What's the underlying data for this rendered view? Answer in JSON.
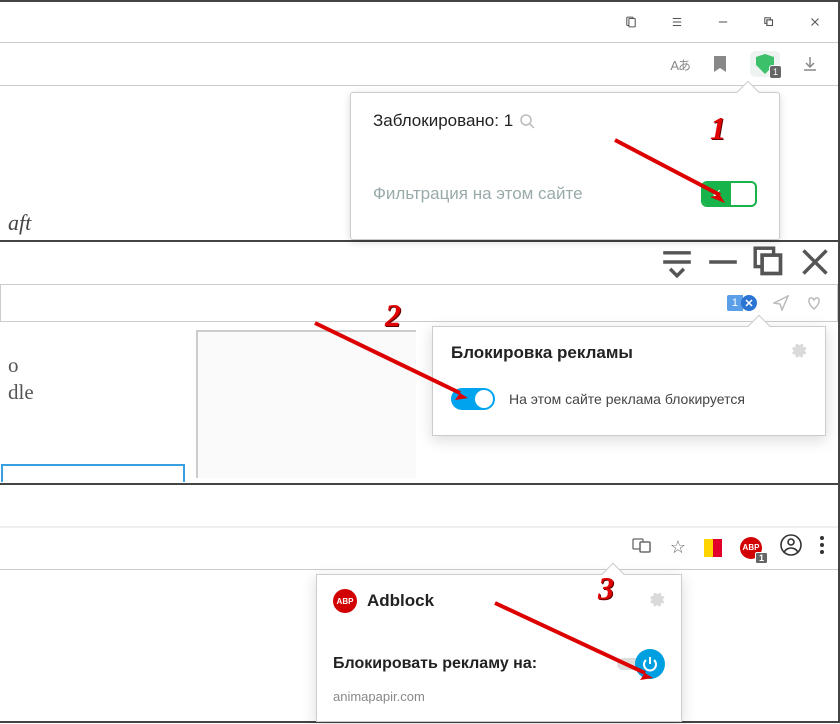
{
  "section1": {
    "window_controls": [
      "bookmarks",
      "menu",
      "minimize",
      "maximize",
      "close"
    ],
    "toolbar": {
      "translate_label": "Aあ",
      "extension_badge": "1"
    },
    "popup": {
      "blocked_label": "Заблокировано: 1",
      "filter_label": "Фильтрация на этом сайте",
      "toggle_on": true,
      "check": "✓"
    },
    "page_fragment": "aft"
  },
  "section2": {
    "toolbar": {
      "ext_count": "1",
      "stop_mark": "✕"
    },
    "popup": {
      "title": "Блокировка рекламы",
      "status_text": "На этом сайте реклама блокируется",
      "toggle_on": true
    },
    "page_fragment_line1": "o",
    "page_fragment_line2": "dle"
  },
  "section3": {
    "toolbar": {
      "abp_badge": "1",
      "abp_text": "ABP"
    },
    "popup": {
      "brand_abbr": "ABP",
      "brand": "Adblock",
      "block_label": "Блокировать рекламу на:",
      "domain": "animapapir.com",
      "toggle_on": true
    }
  },
  "annotations": {
    "n1": "1",
    "n2": "2",
    "n3": "3"
  }
}
